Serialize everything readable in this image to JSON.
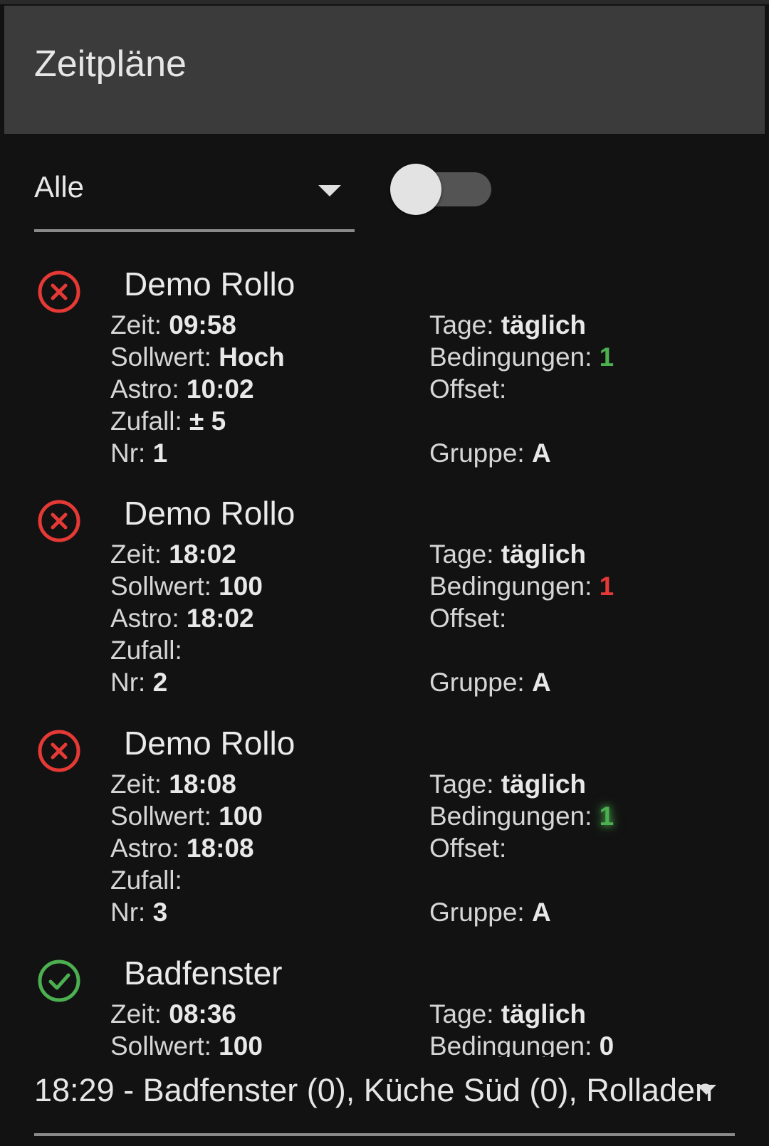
{
  "header": {
    "title": "Zeitpläne"
  },
  "filter": {
    "selected": "Alle"
  },
  "toggle": {
    "enabled": false
  },
  "schedules": [
    {
      "status": "error",
      "name": "Demo Rollo",
      "zeit_label": "Zeit:",
      "zeit": "09:58",
      "sollwert_label": "Sollwert:",
      "sollwert": "Hoch",
      "astro_label": "Astro:",
      "astro": "10:02",
      "zufall_label": "Zufall:",
      "zufall": "± 5",
      "nr_label": "Nr:",
      "nr": "1",
      "tage_label": "Tage:",
      "tage": "täglich",
      "bedingungen_label": "Bedingungen:",
      "bedingungen": "1",
      "bedingungen_color": "#4caf50",
      "offset_label": "Offset:",
      "offset": "",
      "gruppe_label": "Gruppe:",
      "gruppe": "A"
    },
    {
      "status": "error",
      "name": "Demo Rollo",
      "zeit_label": "Zeit:",
      "zeit": "18:02",
      "sollwert_label": "Sollwert:",
      "sollwert": "100",
      "astro_label": "Astro:",
      "astro": "18:02",
      "zufall_label": "Zufall:",
      "zufall": "",
      "nr_label": "Nr:",
      "nr": "2",
      "tage_label": "Tage:",
      "tage": "täglich",
      "bedingungen_label": "Bedingungen:",
      "bedingungen": "1",
      "bedingungen_color": "#e53935",
      "offset_label": "Offset:",
      "offset": "",
      "gruppe_label": "Gruppe:",
      "gruppe": "A"
    },
    {
      "status": "error",
      "name": "Demo Rollo",
      "zeit_label": "Zeit:",
      "zeit": "18:08",
      "sollwert_label": "Sollwert:",
      "sollwert": "100",
      "astro_label": "Astro:",
      "astro": "18:08",
      "zufall_label": "Zufall:",
      "zufall": "",
      "nr_label": "Nr:",
      "nr": "3",
      "tage_label": "Tage:",
      "tage": "täglich",
      "bedingungen_label": "Bedingungen:",
      "bedingungen": "1",
      "bedingungen_color": "#4caf50",
      "offset_label": "Offset:",
      "offset": "",
      "gruppe_label": "Gruppe:",
      "gruppe": "A"
    },
    {
      "status": "ok",
      "name": "Badfenster",
      "zeit_label": "Zeit:",
      "zeit": "08:36",
      "sollwert_label": "Sollwert:",
      "sollwert": "100",
      "tage_label": "Tage:",
      "tage": "täglich",
      "bedingungen_label": "Bedingungen:",
      "bedingungen": "0"
    }
  ],
  "colors": {
    "error": "#e53935",
    "ok": "#4caf50",
    "background": "#121212",
    "header": "#3b3b3b"
  },
  "icons": {
    "error": "close-circle-icon",
    "ok": "check-circle-icon",
    "dropdown": "chevron-down-icon"
  },
  "bottom_select": {
    "value": "18:29 - Badfenster (0), Küche Süd (0), Rolladen"
  }
}
